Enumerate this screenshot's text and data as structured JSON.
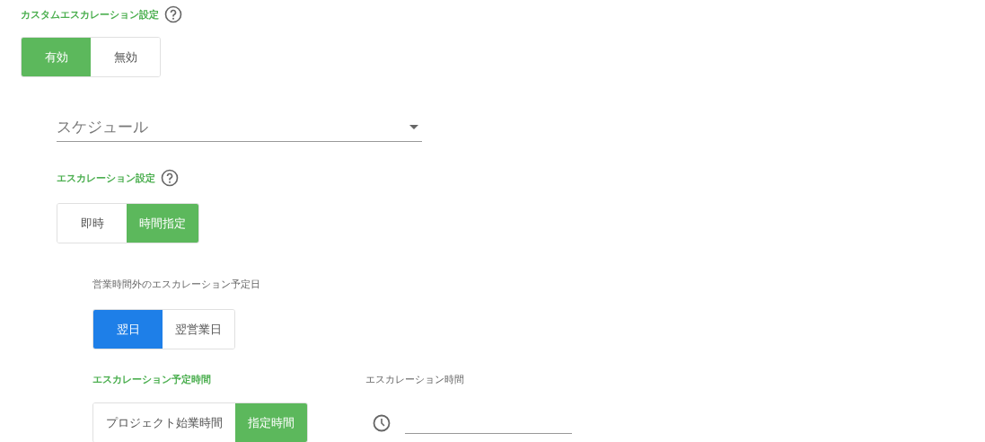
{
  "custom_escalation": {
    "title": "カスタムエスカレーション設定",
    "toggle": {
      "color": "#5cb85c",
      "options": [
        {
          "label": "有効",
          "selected": true
        },
        {
          "label": "無効",
          "selected": false
        }
      ]
    }
  },
  "schedule_select": {
    "placeholder": "スケジュール"
  },
  "escalation_settings": {
    "title": "エスカレーション設定",
    "toggle": {
      "color": "#5cb85c",
      "options": [
        {
          "label": "即時",
          "selected": false
        },
        {
          "label": "時間指定",
          "selected": true
        }
      ]
    }
  },
  "off_hours_day": {
    "label": "営業時間外のエスカレーション予定日",
    "toggle": {
      "color": "#1e7fe8",
      "options": [
        {
          "label": "翌日",
          "selected": true
        },
        {
          "label": "翌営業日",
          "selected": false
        }
      ]
    }
  },
  "planned_time": {
    "title": "エスカレーション予定時間",
    "toggle": {
      "color": "#5cb85c",
      "options": [
        {
          "label": "プロジェクト始業時間",
          "selected": false
        },
        {
          "label": "指定時間",
          "selected": true
        }
      ]
    }
  },
  "escalation_time": {
    "label": "エスカレーション時間"
  }
}
